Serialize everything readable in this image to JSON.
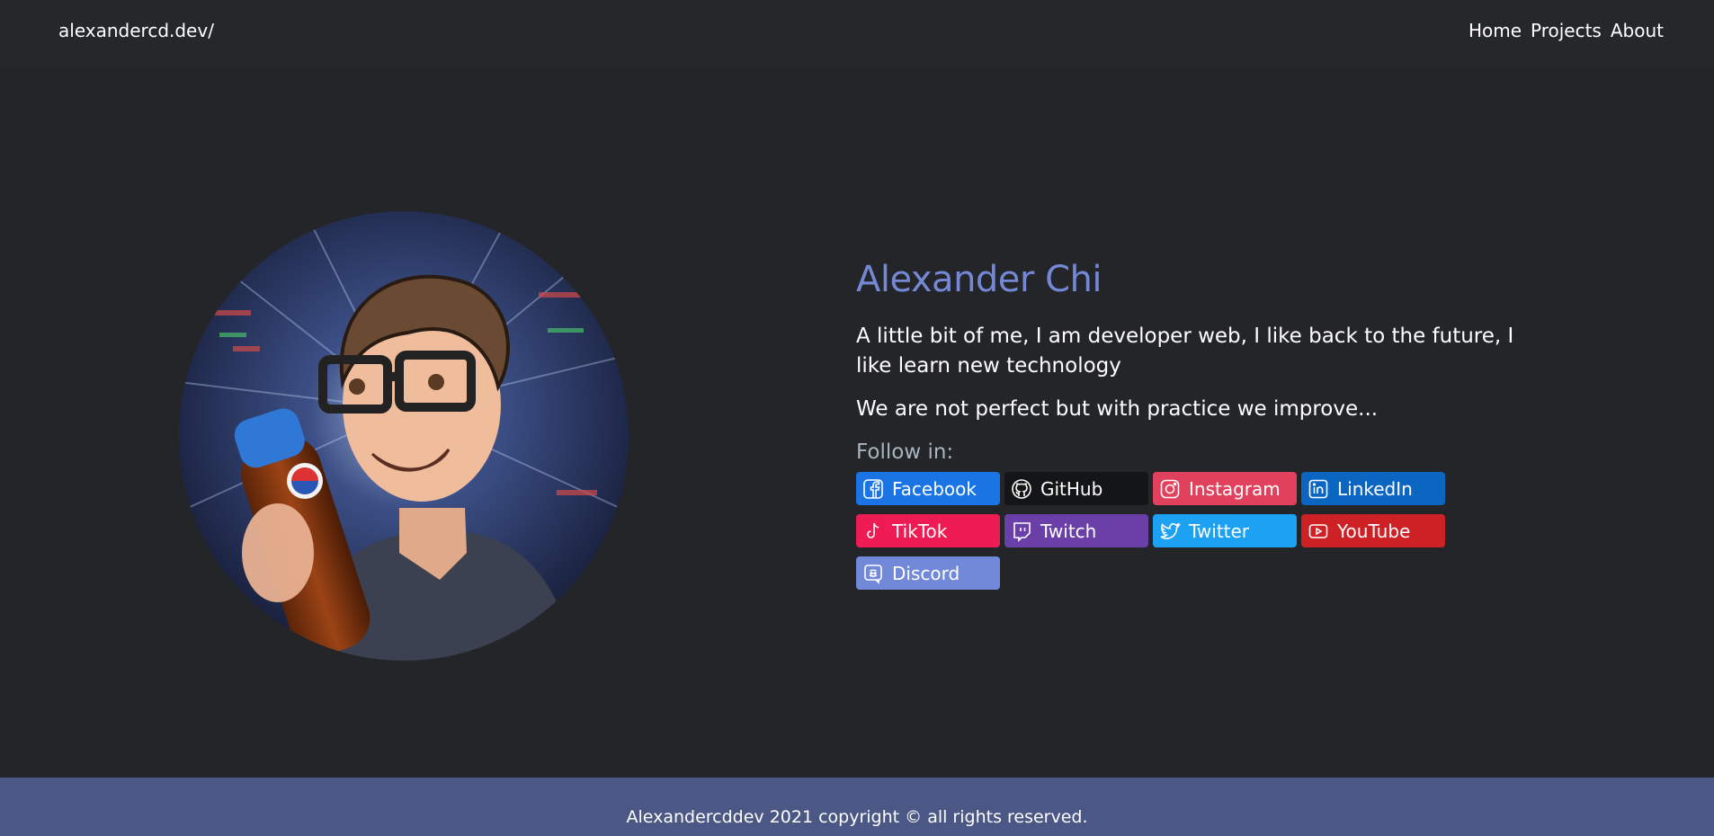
{
  "nav": {
    "brand": "alexandercd.dev/",
    "links": [
      {
        "label": "Home"
      },
      {
        "label": "Projects"
      },
      {
        "label": "About"
      }
    ]
  },
  "profile": {
    "name": "Alexander Chi",
    "bio": "A little bit of me, I am developer web, I like back to the future, I like learn new technology",
    "motto": "We are not perfect but with practice we improve...",
    "follow_label": "Follow in:"
  },
  "socials": [
    {
      "label": "Facebook",
      "icon": "facebook-icon",
      "color": "#1b74e4"
    },
    {
      "label": "GitHub",
      "icon": "github-icon",
      "color": "#141517"
    },
    {
      "label": "Instagram",
      "icon": "instagram-icon",
      "color": "#e1415d"
    },
    {
      "label": "LinkedIn",
      "icon": "linkedin-icon",
      "color": "#0b66c2"
    },
    {
      "label": "TikTok",
      "icon": "tiktok-icon",
      "color": "#ef1b54"
    },
    {
      "label": "Twitch",
      "icon": "twitch-icon",
      "color": "#6a40a8"
    },
    {
      "label": "Twitter",
      "icon": "twitter-icon",
      "color": "#1da1f2"
    },
    {
      "label": "YouTube",
      "icon": "youtube-icon",
      "color": "#cd2126"
    },
    {
      "label": "Discord",
      "icon": "discord-icon",
      "color": "#7289da"
    }
  ],
  "footer": {
    "text": "Alexandercddev 2021 copyright © all rights reserved."
  },
  "colors": {
    "background": "#232528",
    "navbar": "#25272b",
    "accent_name": "#7488d6",
    "follow_label": "#a8b4bf",
    "footer": "#4b5785"
  }
}
